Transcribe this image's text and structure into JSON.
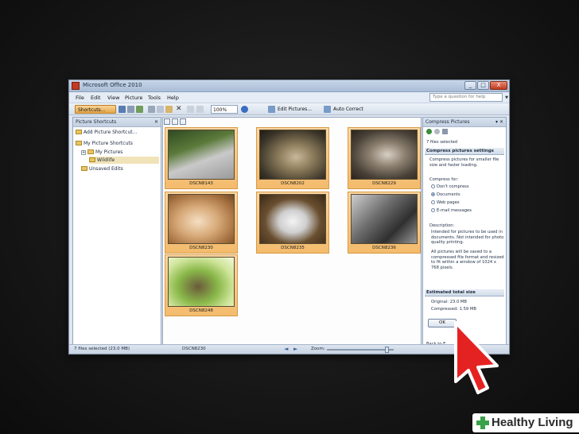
{
  "window": {
    "title": "Microsoft Office 2010",
    "buttons": {
      "minimize": "_",
      "maximize": "□",
      "close": "X"
    }
  },
  "menubar": {
    "items": [
      "File",
      "Edit",
      "View",
      "Picture",
      "Tools",
      "Help"
    ],
    "help_placeholder": "Type a question for help"
  },
  "toolbar": {
    "shortcuts_label": "Shortcuts...",
    "zoom_value": "100%",
    "edit_pictures_label": "Edit Pictures...",
    "auto_correct_label": "Auto Correct"
  },
  "left_pane": {
    "title": "Picture Shortcuts",
    "add_shortcut": "Add Picture Shortcut...",
    "tree": {
      "root": "My Picture Shortcuts",
      "my_pictures": "My Pictures",
      "wildlife": "Wildlife",
      "unsaved": "Unsaved Edits"
    }
  },
  "status": {
    "selection": "7 files selected (23.0 MB)",
    "current_file": "DSCN8230",
    "zoom_label": "Zoom:"
  },
  "thumbnails": [
    {
      "caption": "DSCN8143"
    },
    {
      "caption": "DSCN8202"
    },
    {
      "caption": "DSCN8229"
    },
    {
      "caption": "DSCN8230"
    },
    {
      "caption": "DSCN8235"
    },
    {
      "caption": "DSCN8236"
    },
    {
      "caption": "DSCN8248"
    }
  ],
  "task_pane": {
    "title": "Compress Pictures",
    "files_selected": "7 files selected",
    "settings_header": "Compress pictures settings",
    "settings_desc": "Compress pictures for smaller file size and faster loading.",
    "compress_for_label": "Compress for:",
    "options": [
      "Don't compress",
      "Documents",
      "Web pages",
      "E-mail messages"
    ],
    "selected_option": 1,
    "description_label": "Description:",
    "description_1": "Intended for pictures to be used in documents. Not intended for photo quality printing.",
    "description_2": "All pictures will be saved to a compressed file format and resized to fit within a window of 1024 x 768 pixels.",
    "estimated_header": "Estimated total size",
    "original": "Original:    23.0 MB",
    "compressed": "Compressed:    1.59 MB",
    "ok_label": "OK",
    "back_label": "Back to E"
  },
  "branding": {
    "text": "Healthy Living"
  },
  "colors": {
    "accent_orange": "#f3bb6c",
    "cursor_red": "#e52222",
    "brand_green": "#3aa14b"
  }
}
